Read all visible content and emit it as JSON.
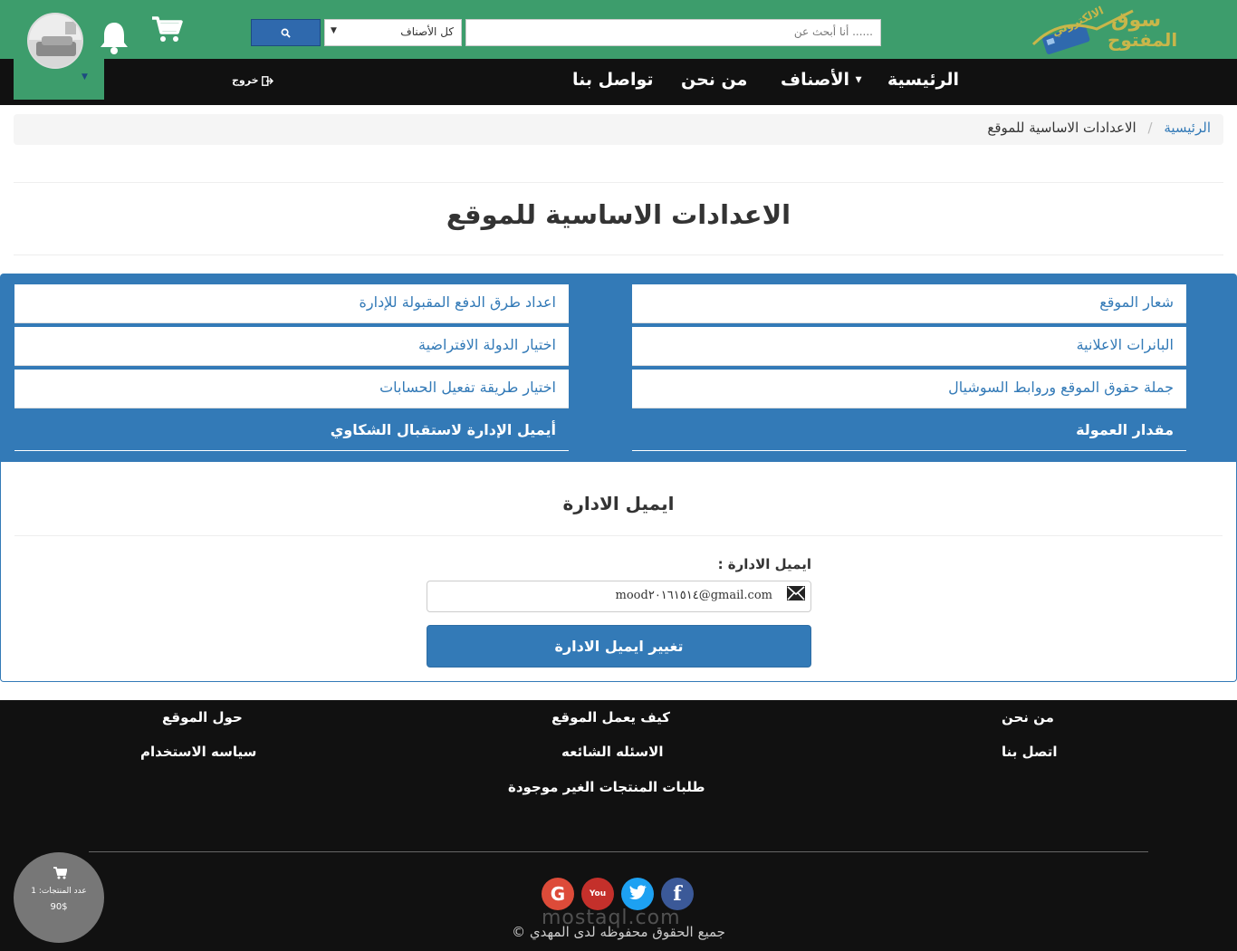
{
  "header": {
    "logo_alt": "سوق المفتوح الالكتروني",
    "search": {
      "placeholder": "أنا أبحث عن ......"
    },
    "category_select": {
      "selected": "كل الأصناف"
    },
    "colors": {
      "topbar": "#3d9d6c",
      "navbar": "#111111",
      "accent": "#337ab7"
    }
  },
  "nav": {
    "items": [
      {
        "label": "الرئيسية"
      },
      {
        "label": "الأصناف"
      },
      {
        "label": "من نحن"
      },
      {
        "label": "تواصل بنا"
      }
    ],
    "logout_label": "خروج"
  },
  "breadcrumb": {
    "home": "الرئيسية",
    "separator": "/",
    "current": "الاعدادات الاساسية للموقع"
  },
  "page": {
    "title": "الاعدادات الاساسية للموقع"
  },
  "settings": {
    "right_column": [
      {
        "label": "شعار الموقع"
      },
      {
        "label": "البانرات الاعلانية"
      },
      {
        "label": "جملة حقوق الموقع وروابط السوشيال"
      },
      {
        "label": "مقدار العمولة"
      }
    ],
    "left_column": [
      {
        "label": "اعداد طرق الدفع المقبولة للإدارة"
      },
      {
        "label": "اختيار الدولة الافتراضية"
      },
      {
        "label": "اختيار طريقة تفعيل الحسابات"
      },
      {
        "label": "أيميل الإدارة لاستقبال الشكاوي"
      }
    ]
  },
  "form": {
    "title": "ايميل الادارة",
    "label": "ايميل الادارة :",
    "email_value": "mood٢٠١٦١٥١٤@gmail.com",
    "submit_label": "تغيير ايميل الادارة"
  },
  "footer": {
    "col_right": [
      "من نحن",
      "اتصل بنا"
    ],
    "col_middle": [
      "كيف يعمل الموقع",
      "الاسئله الشائعه",
      "طلبات المنتجات الغير موجودة"
    ],
    "col_left": [
      "حول الموقع",
      "سياسه الاستخدام"
    ],
    "social": [
      {
        "icon": "facebook-icon",
        "glyph": "f",
        "color": "#3b5998"
      },
      {
        "icon": "twitter-icon",
        "glyph": "t",
        "color": "#1da1f2"
      },
      {
        "icon": "youtube-icon",
        "glyph": "You",
        "color": "#c4302b"
      },
      {
        "icon": "google-icon",
        "glyph": "G",
        "color": "#dd4b39"
      }
    ],
    "copyright": "جميع الحقوق محفوظه لدى المهدي ©",
    "watermark": "mostaql.com"
  },
  "floating_cart": {
    "count_label": "عدد المنتجات: 1",
    "total": "90$"
  }
}
